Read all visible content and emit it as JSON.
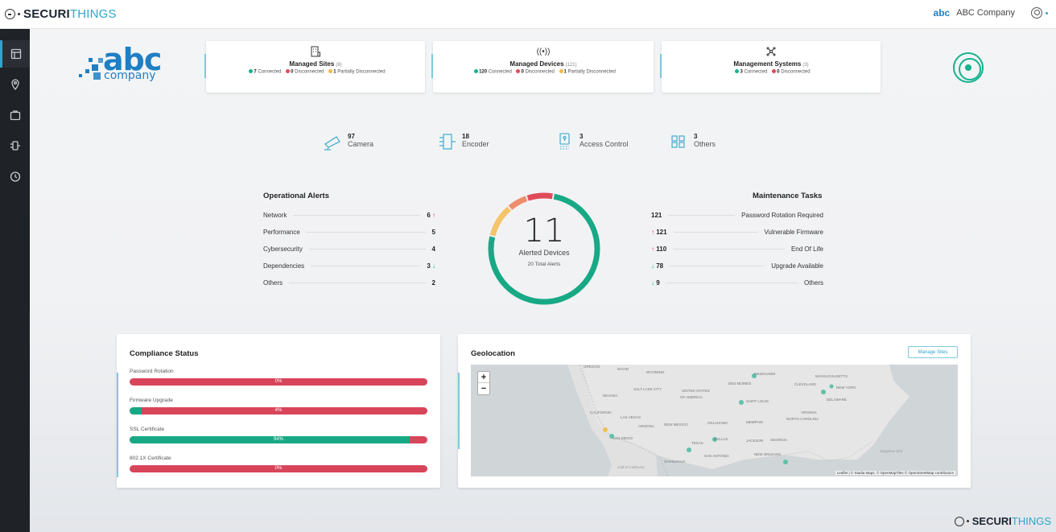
{
  "app": {
    "brand_main": "SECURI",
    "brand_accent": "THINGS"
  },
  "topbar": {
    "company_logo_text": "abc",
    "company_logo_sub": "company",
    "company_name": "ABC Company"
  },
  "sidebar": {
    "items": [
      {
        "icon": "dashboard-icon",
        "active": true
      },
      {
        "icon": "location-icon",
        "active": false
      },
      {
        "icon": "briefcase-icon",
        "active": false
      },
      {
        "icon": "device-icon",
        "active": false
      },
      {
        "icon": "timer-icon",
        "active": false
      }
    ]
  },
  "company": {
    "logo_text": "abc",
    "logo_sub": "company"
  },
  "cards": [
    {
      "icon": "building-icon",
      "title": "Managed Sites",
      "count": "(8)",
      "stats": [
        {
          "color": "#17b28f",
          "value": "7",
          "label": "Connected"
        },
        {
          "color": "#e04a5a",
          "value": "0",
          "label": "Disconnected"
        },
        {
          "color": "#f2b84b",
          "value": "1",
          "label": "Partially Disconnected"
        }
      ]
    },
    {
      "icon": "broadcast-icon",
      "title": "Managed Devices",
      "count": "(121)",
      "stats": [
        {
          "color": "#17b28f",
          "value": "120",
          "label": "Connected"
        },
        {
          "color": "#e04a5a",
          "value": "0",
          "label": "Disconnected"
        },
        {
          "color": "#f2b84b",
          "value": "1",
          "label": "Partially Disconnected"
        }
      ]
    },
    {
      "icon": "network-icon",
      "title": "Management Systems",
      "count": "(3)",
      "stats": [
        {
          "color": "#17b28f",
          "value": "3",
          "label": "Connected"
        },
        {
          "color": "#e04a5a",
          "value": "0",
          "label": "Disconnected"
        }
      ]
    }
  ],
  "device_types": [
    {
      "count": "97",
      "label": "Camera"
    },
    {
      "count": "18",
      "label": "Encoder"
    },
    {
      "count": "3",
      "label": "Access Control"
    },
    {
      "count": "3",
      "label": "Others"
    }
  ],
  "operational_alerts": {
    "title": "Operational Alerts",
    "rows": [
      {
        "label": "Network",
        "value": "6",
        "trend": "↑"
      },
      {
        "label": "Performance",
        "value": "5",
        "trend": ""
      },
      {
        "label": "Cybersecurity",
        "value": "4",
        "trend": ""
      },
      {
        "label": "Dependencies",
        "value": "3",
        "trend": "↓"
      },
      {
        "label": "Others",
        "value": "2",
        "trend": ""
      }
    ]
  },
  "alerted": {
    "count": "11",
    "label": "Alerted Devices",
    "total": "20 Total Alerts",
    "segments": [
      {
        "color": "#17a985",
        "fraction": 0.76
      },
      {
        "color": "#f5c36a",
        "fraction": 0.1
      },
      {
        "color": "#ef8c6a",
        "fraction": 0.06
      },
      {
        "color": "#e04a5a",
        "fraction": 0.08
      }
    ]
  },
  "maintenance_tasks": {
    "title": "Maintenance Tasks",
    "rows": [
      {
        "value": "121",
        "trend": "",
        "label": "Password Rotation Required"
      },
      {
        "value": "121",
        "trend": "↑",
        "label": "Vulnerable Firmware"
      },
      {
        "value": "110",
        "trend": "↑",
        "label": "End Of Life"
      },
      {
        "value": "78",
        "trend": "↓",
        "label": "Upgrade Available"
      },
      {
        "value": "9",
        "trend": "↓",
        "label": "Others"
      }
    ]
  },
  "compliance": {
    "title": "Compliance Status",
    "items": [
      {
        "label": "Password Rotation",
        "percent": 0,
        "pct_text": "0%"
      },
      {
        "label": "Firmware Upgrade",
        "percent": 4,
        "pct_text": "4%"
      },
      {
        "label": "SSL Certificate",
        "percent": 94,
        "pct_text": "94%"
      },
      {
        "label": "802.1X Certificate",
        "percent": 0,
        "pct_text": "0%"
      }
    ]
  },
  "geolocation": {
    "title": "Geolocation",
    "manage_button": "Manage Sites",
    "zoom_in": "+",
    "zoom_out": "−",
    "attribution": "Leaflet | © Stadia Maps, © OpenMapTiles © OpenStreetMap contributors",
    "cities": [
      "OREGON",
      "IDAHO",
      "WYOMING",
      "MILWAUKEE",
      "MASSACHUSETTS",
      "SALT LAKE CITY",
      "UNITED STATES",
      "OF AMERICA",
      "DES MOINES",
      "CLEVELAND",
      "NEW YORK",
      "NEVADA",
      "SAINT LOUIS",
      "DELAWARE",
      "CALIFORNIA",
      "LAS VEGAS",
      "VIRGINIA",
      "ARIZONA",
      "NEW MEXICO",
      "OKLAHOMA",
      "MEMPHIS",
      "NORTH CAROLINA",
      "SAN DIEGO",
      "DALLAS",
      "TEXAS",
      "JACKSON",
      "GEORGIA",
      "NEW ORLEANS",
      "Sargasso Sea",
      "Gulf of California",
      "CHIHUAHUA",
      "SAN ANTONIO"
    ]
  },
  "colors": {
    "accent": "#2ea5c9",
    "green": "#17b28f",
    "red": "#e04a5a",
    "yellow": "#f2b84b"
  }
}
